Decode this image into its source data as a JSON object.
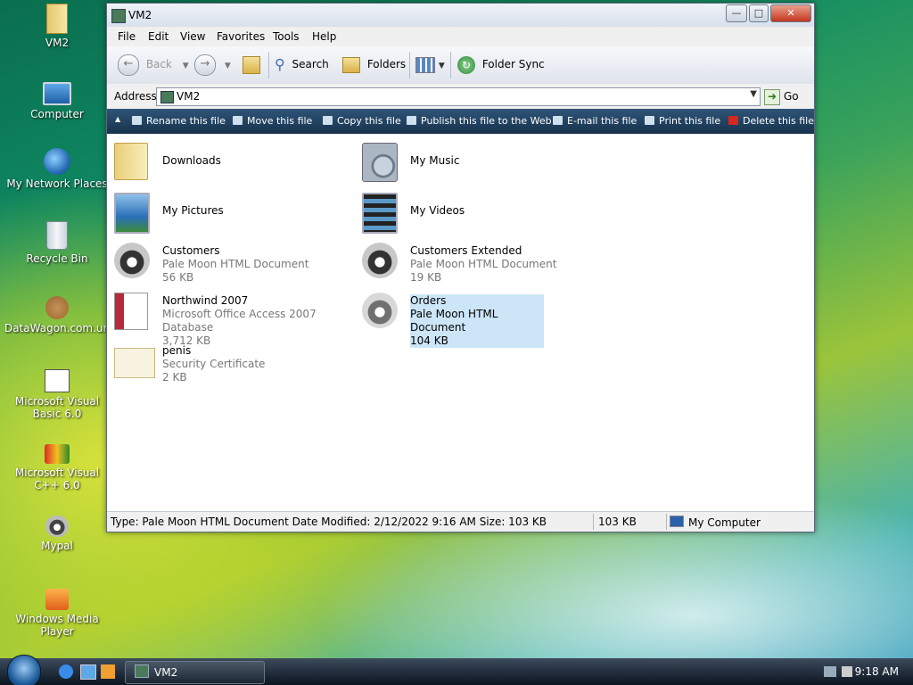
{
  "desktop_icons": [
    {
      "label": "VM2",
      "icon": "folder-icon"
    },
    {
      "label": "Computer",
      "icon": "computer-icon"
    },
    {
      "label": "My Network Places",
      "icon": "network-icon"
    },
    {
      "label": "Recycle Bin",
      "icon": "recycle-bin-icon"
    },
    {
      "label": "DataWagon.com.url",
      "icon": "url-shortcut-icon"
    },
    {
      "label": "Microsoft Visual Basic 6.0",
      "icon": "visual-basic-icon"
    },
    {
      "label": "Microsoft Visual C++ 6.0",
      "icon": "visual-cpp-icon"
    },
    {
      "label": "Mypal",
      "icon": "mypal-icon"
    },
    {
      "label": "Windows Media Player",
      "icon": "media-player-icon"
    }
  ],
  "window": {
    "title": "VM2",
    "menu": [
      "File",
      "Edit",
      "View",
      "Favorites",
      "Tools",
      "Help"
    ],
    "toolbar": {
      "back": "Back",
      "search": "Search",
      "folders": "Folders",
      "folder_sync": "Folder Sync"
    },
    "address": {
      "label": "Address",
      "value": "VM2",
      "go": "Go"
    },
    "tasks": [
      "Rename this file",
      "Move this file",
      "Copy this file",
      "Publish this file to the Web",
      "E-mail this file",
      "Print this file",
      "Delete this file"
    ],
    "items": [
      {
        "name": "Downloads",
        "type": "",
        "size": "",
        "icon": "folder-icon"
      },
      {
        "name": "My Music",
        "type": "",
        "size": "",
        "icon": "music-folder-icon"
      },
      {
        "name": "My Pictures",
        "type": "",
        "size": "",
        "icon": "pictures-folder-icon"
      },
      {
        "name": "My Videos",
        "type": "",
        "size": "",
        "icon": "videos-folder-icon"
      },
      {
        "name": "Customers",
        "type": "Pale Moon HTML Document",
        "size": "56 KB",
        "icon": "pale-moon-html-icon"
      },
      {
        "name": "Customers Extended",
        "type": "Pale Moon HTML Document",
        "size": "19 KB",
        "icon": "pale-moon-html-icon"
      },
      {
        "name": "Northwind 2007",
        "type": "Microsoft Office Access 2007 Database",
        "size": "3,712 KB",
        "icon": "access-database-icon"
      },
      {
        "name": "Orders",
        "type": "Pale Moon HTML Document",
        "size": "104 KB",
        "icon": "pale-moon-html-icon"
      },
      {
        "name": "penis",
        "type": "Security Certificate",
        "size": "2 KB",
        "icon": "certificate-icon"
      }
    ],
    "status": {
      "details": "Type: Pale Moon HTML Document Date Modified: 2/12/2022 9:16 AM Size: 103 KB",
      "size": "103 KB",
      "zone": "My Computer"
    }
  },
  "taskbar": {
    "window_button": "VM2",
    "clock": "9:18 AM"
  },
  "colors": {
    "selection": "#cce6f7",
    "tasks_bar": "#1f3f5f",
    "close_button": "#c5361f"
  }
}
